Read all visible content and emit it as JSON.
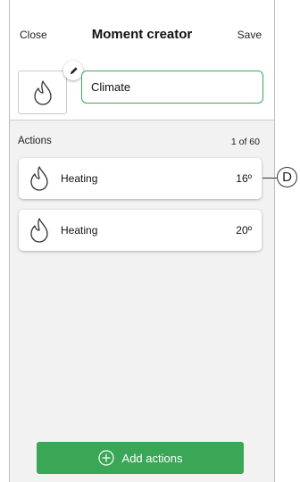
{
  "header": {
    "close_label": "Close",
    "title": "Moment creator",
    "save_label": "Save"
  },
  "moment": {
    "icon": "flame-icon",
    "edit_icon": "pencil-icon",
    "name_value": "Climate"
  },
  "actions": {
    "label": "Actions",
    "count": "1 of 60",
    "items": [
      {
        "icon": "flame-icon",
        "label": "Heating",
        "value": "16º"
      },
      {
        "icon": "flame-icon",
        "label": "Heating",
        "value": "20º"
      }
    ]
  },
  "add_button": {
    "icon": "plus-circle-icon",
    "label": "Add actions"
  },
  "callout": {
    "letter": "D"
  },
  "colors": {
    "accent": "#3aa757",
    "background": "#f2f2f2"
  }
}
